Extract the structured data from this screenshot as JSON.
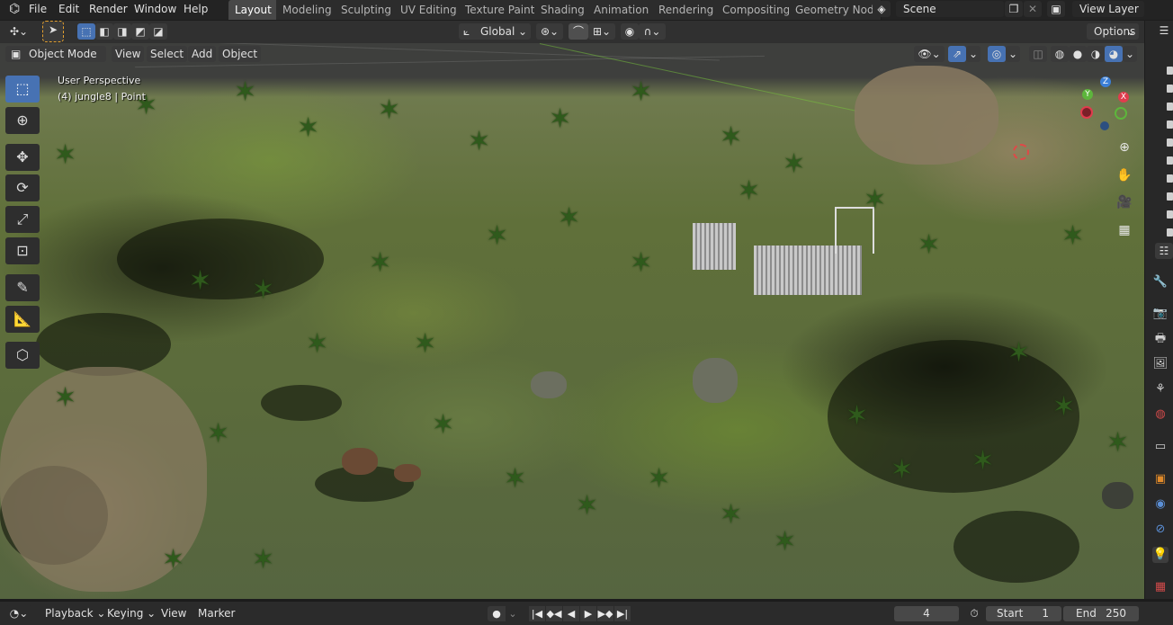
{
  "menubar": {
    "items": [
      "File",
      "Edit",
      "Render",
      "Window",
      "Help"
    ],
    "workspace_tabs": [
      "Layout",
      "Modeling",
      "Sculpting",
      "UV Editing",
      "Texture Paint",
      "Shading",
      "Animation",
      "Rendering",
      "Compositing",
      "Geometry Nod"
    ],
    "active_tab": "Layout",
    "scene_name": "Scene",
    "view_layer": "View Layer"
  },
  "toolbar_header": {
    "transform_orientation": "Global",
    "options_label": "Options"
  },
  "viewport_header": {
    "mode": "Object Mode",
    "menus": [
      "View",
      "Select",
      "Add",
      "Object"
    ]
  },
  "viewport": {
    "perspective_label": "User Perspective",
    "object_info": "(4) jungle8 | Point"
  },
  "gizmo": {
    "axes": [
      "X",
      "Y",
      "Z"
    ],
    "colors": {
      "x": "#e03c4d",
      "y": "#5db63c",
      "z": "#3b7fd6"
    }
  },
  "tools": [
    "select-box-icon",
    "cursor-icon",
    "move-icon",
    "rotate-icon",
    "scale-icon",
    "transform-icon",
    "annotate-icon",
    "measure-icon",
    "add-cube-icon"
  ],
  "properties_icons": [
    "tool-icon",
    "render-icon",
    "output-icon",
    "view-layer-icon",
    "scene-icon",
    "world-icon",
    "collection-icon",
    "object-icon",
    "modifier-icon",
    "particles-icon",
    "physics-icon",
    "data-icon",
    "texture-icon"
  ],
  "timeline": {
    "menus": [
      "Playback",
      "Keying",
      "View",
      "Marker"
    ],
    "current_frame": "4",
    "start_label": "Start",
    "start_value": "1",
    "end_label": "End",
    "end_value": "250"
  },
  "colors": {
    "accent": "#4772b3",
    "active_tab": "#484848"
  }
}
